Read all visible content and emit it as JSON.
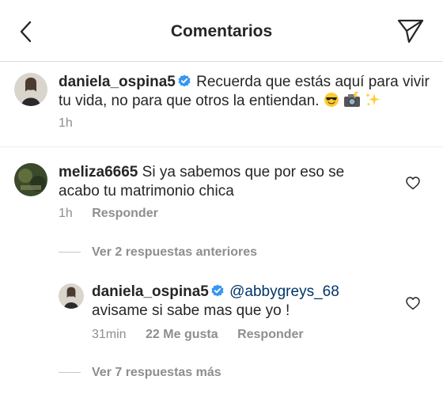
{
  "header": {
    "title": "Comentarios"
  },
  "caption": {
    "username": "daniela_ospina5",
    "text": "Recuerda que estás aquí para vivir tu vida, no para que otros la entiendan.",
    "time": "1h"
  },
  "comment": {
    "username": "meliza6665",
    "text": "Si ya sabemos que por eso se acabo tu matrimonio  chica",
    "time": "1h",
    "reply_label": "Responder"
  },
  "previous_replies_label": "Ver 2 respuestas anteriores",
  "reply": {
    "username": "daniela_ospina5",
    "mention": "@abbygreys_68",
    "text": "avisame si sabe mas que yo !",
    "time": "31min",
    "likes": "22 Me gusta",
    "reply_label": "Responder"
  },
  "more_replies_label": "Ver 7 respuestas más",
  "colors": {
    "text": "#262626",
    "secondary": "#8e8e8e",
    "verified": "#3897f0",
    "mention": "#003569"
  }
}
